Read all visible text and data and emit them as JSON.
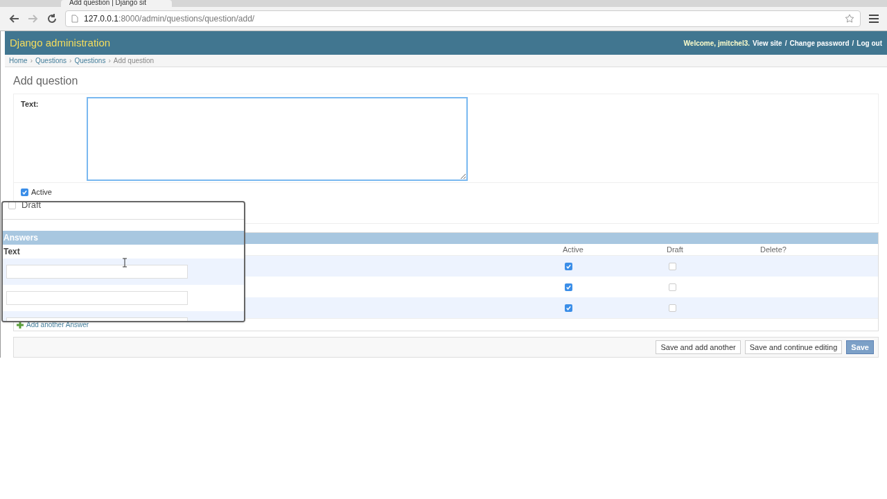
{
  "browser": {
    "tab_title": "Add question | Django sit",
    "url_host": "127.0.0.1",
    "url_path": ":8000/admin/questions/question/add/"
  },
  "header": {
    "title": "Django administration",
    "welcome": "Welcome,",
    "user": "jmitchel3.",
    "links": [
      "View site",
      "Change password",
      "Log out"
    ],
    "separator": "/"
  },
  "breadcrumbs": [
    "Home",
    "Questions",
    "Questions",
    "Add question"
  ],
  "breadcrumb_separator": "›",
  "page_title": "Add question",
  "form": {
    "text_label": "Text:",
    "active": {
      "label": "Active",
      "checked": true
    }
  },
  "magnifier": {
    "draft": {
      "label": "Draft",
      "checked": false
    },
    "section_title": "Answers",
    "column": "Text",
    "rows": [
      {
        "kind": "input"
      },
      {
        "kind": "input"
      },
      {
        "kind": "input"
      }
    ]
  },
  "answers": {
    "columns": [
      "Active",
      "Draft",
      "Delete?"
    ],
    "rows": [
      {
        "active": true,
        "draft": false
      },
      {
        "active": true,
        "draft": false
      },
      {
        "active": true,
        "draft": false
      }
    ],
    "add_link": "Add another Answer"
  },
  "buttons": [
    {
      "label": "Save and add another",
      "kind": "plain"
    },
    {
      "label": "Save and continue editing",
      "kind": "plain"
    },
    {
      "label": "Save",
      "kind": "default"
    }
  ]
}
